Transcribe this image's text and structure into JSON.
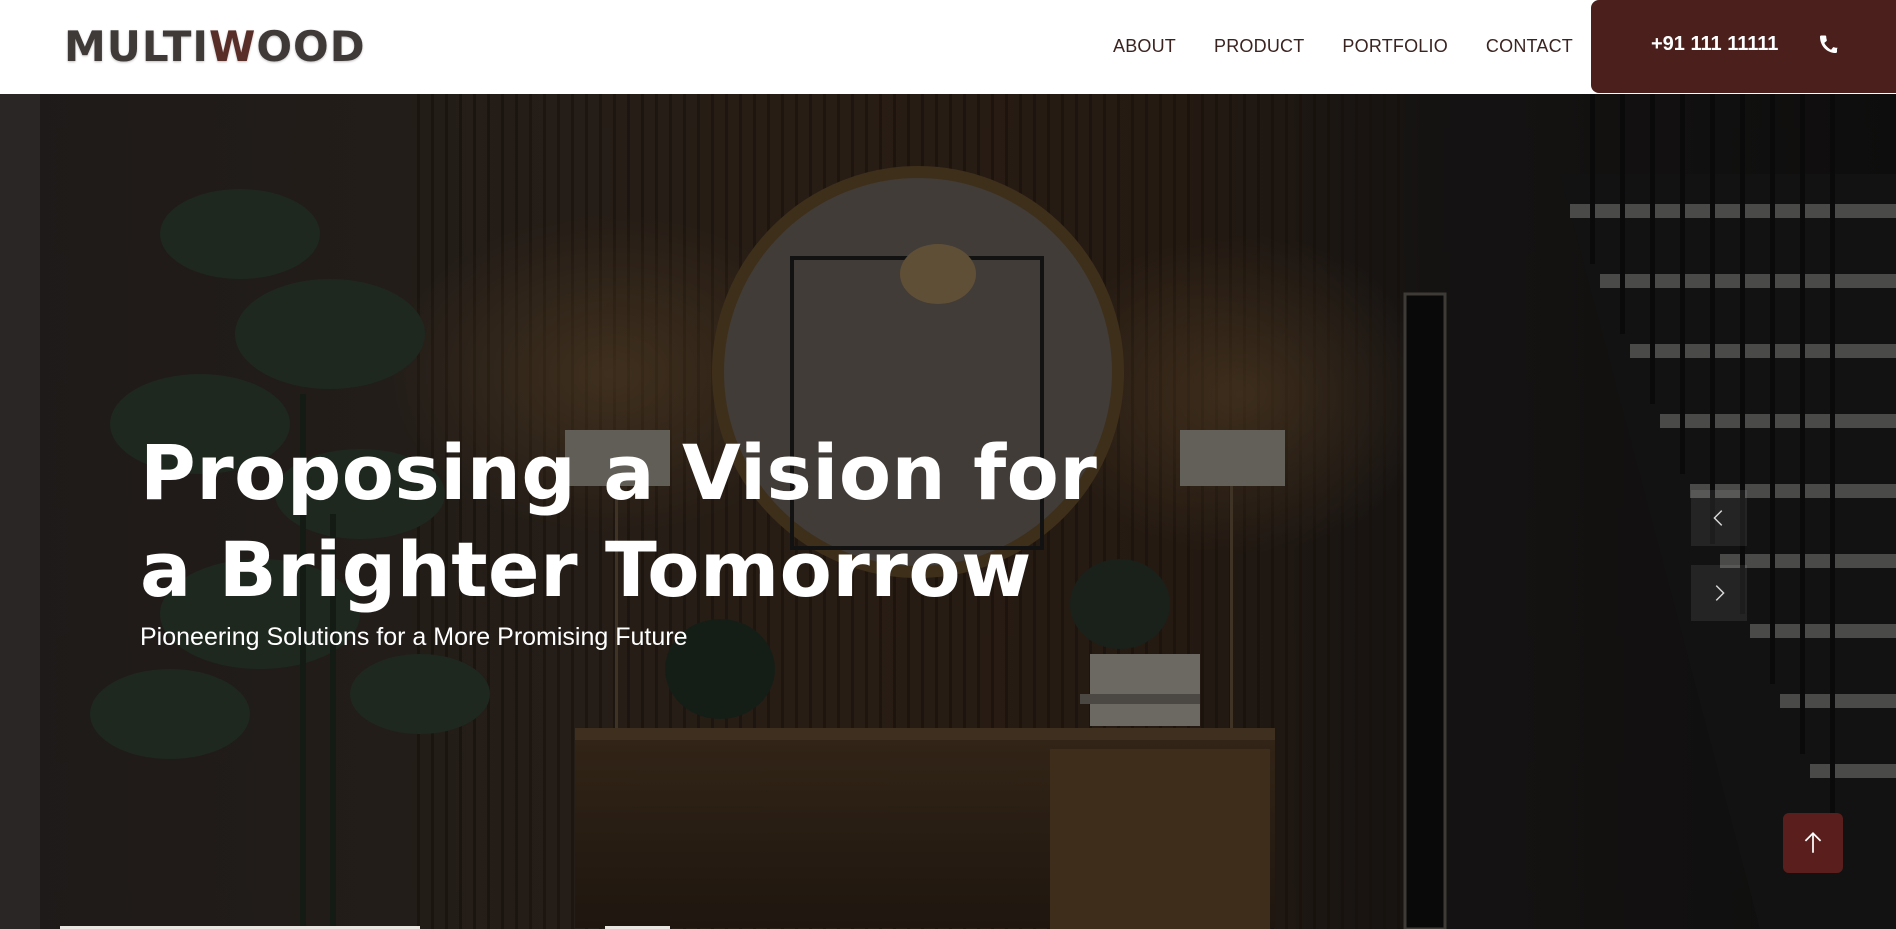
{
  "header": {
    "logo_before": "MULTI",
    "logo_accent": "W",
    "logo_after": "OOD",
    "nav": [
      {
        "label": "ABOUT"
      },
      {
        "label": "PRODUCT"
      },
      {
        "label": "PORTFOLIO"
      },
      {
        "label": "CONTACT"
      }
    ],
    "phone": "+91 111 11111",
    "phone_icon": "phone-icon"
  },
  "hero": {
    "title": "Proposing a Vision for a Brighter Tomorrow",
    "subtitle": "Pioneering Solutions for a More Promising Future",
    "prev_icon": "chevron-left-icon",
    "next_icon": "chevron-right-icon"
  },
  "scroll_top": {
    "icon": "arrow-up-icon"
  },
  "colors": {
    "brand": "#4a1f1c",
    "nav_text": "#3b2320",
    "logo_text": "#3f3a38",
    "hero_text": "#ffffff"
  }
}
